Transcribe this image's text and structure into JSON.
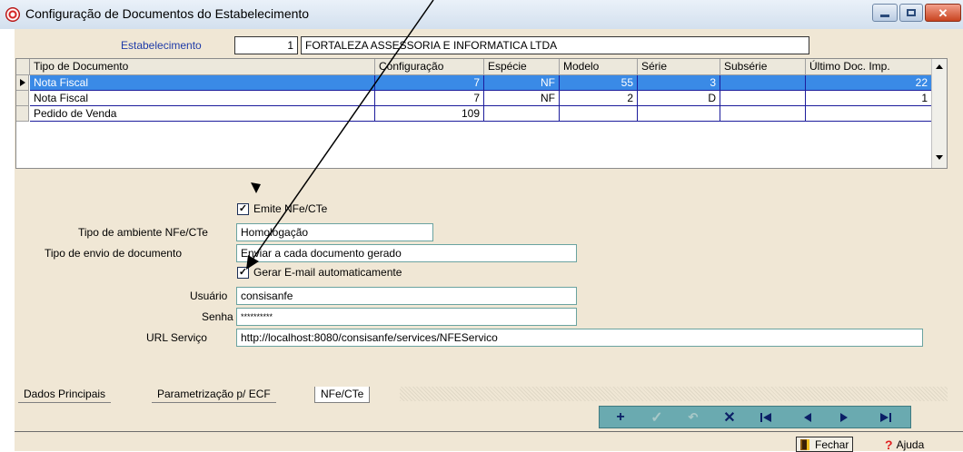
{
  "window": {
    "title": "Configuração de Documentos do Estabelecimento"
  },
  "estabelecimento": {
    "label": "Estabelecimento",
    "code": "1",
    "name": "FORTALEZA ASSESSORIA E INFORMATICA LTDA"
  },
  "grid": {
    "columns": [
      "Tipo de Documento",
      "Configuração",
      "Espécie",
      "Modelo",
      "Série",
      "Subsérie",
      "Último Doc. Imp."
    ],
    "rows": [
      {
        "tipo": "Nota Fiscal",
        "config": "7",
        "especie": "NF",
        "modelo": "55",
        "serie": "3",
        "subserie": "",
        "ultimo": "22"
      },
      {
        "tipo": "Nota Fiscal",
        "config": "7",
        "especie": "NF",
        "modelo": "2",
        "serie": "D",
        "subserie": "",
        "ultimo": "1"
      },
      {
        "tipo": "Pedido de Venda",
        "config": "109",
        "especie": "",
        "modelo": "",
        "serie": "",
        "subserie": "",
        "ultimo": ""
      }
    ]
  },
  "nfe": {
    "emite_label": "Emite NFe/CTe",
    "emite_checked": true,
    "ambiente_label": "Tipo de ambiente NFe/CTe",
    "ambiente_value": "Homologação",
    "envio_label": "Tipo de envio de documento",
    "envio_value": "Enviar a cada documento gerado",
    "email_label": "Gerar E-mail automaticamente",
    "email_checked": true,
    "usuario_label": "Usuário",
    "usuario_value": "consisanfe",
    "senha_label": "Senha",
    "senha_value": "**********",
    "url_label": "URL Serviço",
    "url_value": "http://localhost:8080/consisanfe/services/NFEServico"
  },
  "tabs": [
    "Dados Principais",
    "Parametrização p/ ECF",
    "NFe/CTe"
  ],
  "active_tab": "NFe/CTe",
  "buttons": {
    "fechar": "Fechar",
    "ajuda": "Ajuda"
  },
  "colors": {
    "selected_row": "#3a8ae6",
    "form_bg": "#f0e7d5",
    "nav_bar": "#6aaab0",
    "label_blue": "#1f3ba8"
  },
  "icons": [
    "radio-app-icon",
    "add-icon",
    "confirm-icon",
    "undo-icon",
    "delete-icon",
    "first-icon",
    "prev-icon",
    "next-icon",
    "last-icon",
    "door-exit-icon",
    "help-icon"
  ]
}
